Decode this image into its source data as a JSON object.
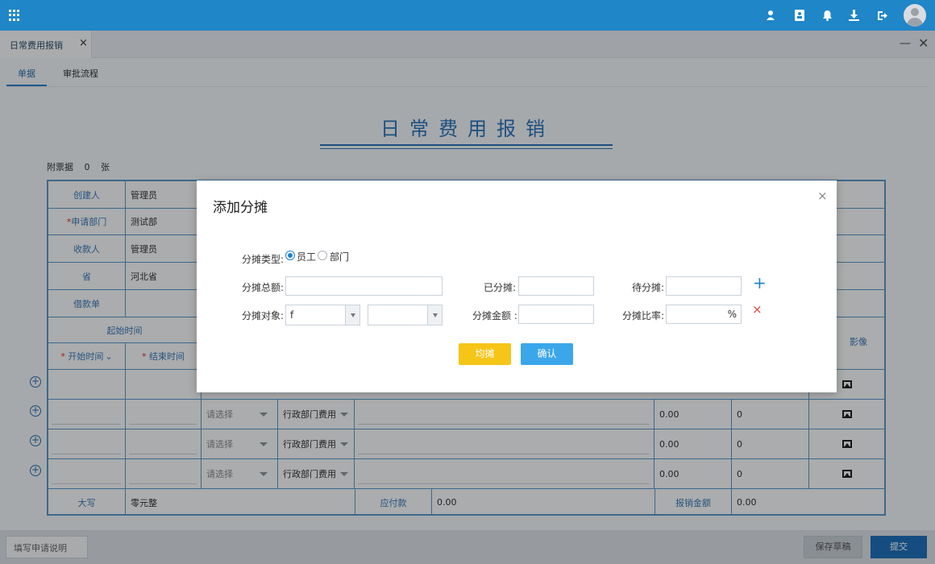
{
  "header": {
    "icons": [
      "apps-icon",
      "user-icon",
      "contacts-icon",
      "bell-icon",
      "download-icon",
      "logout-icon"
    ],
    "accent": "#1f86c8"
  },
  "tab": {
    "title": "日常费用报销",
    "close": "×"
  },
  "window": {
    "minimize": "—",
    "close": "✕"
  },
  "subtabs": [
    "单据",
    "审批流程"
  ],
  "form": {
    "title": "日常费用报销",
    "attach_label": "附票据",
    "attach_count": "0",
    "attach_unit": "张",
    "rows": [
      {
        "label": "创建人",
        "value": "管理员",
        "required": false
      },
      {
        "label": "申请部门",
        "value": "测试部",
        "required": true
      },
      {
        "label": "收款人",
        "value": "管理员",
        "required": false
      },
      {
        "label": "省",
        "value": "河北省",
        "required": false
      },
      {
        "label": "借款单",
        "value": "",
        "required": false
      }
    ],
    "start_time_header": "起始时间",
    "start_col": "开始时间",
    "end_col": "结束时间",
    "image_col": "影像",
    "line_items": [
      {
        "select": "",
        "type": "",
        "amount": "",
        "ratio": ""
      },
      {
        "select": "请选择",
        "type": "行政部门费用",
        "amount": "0.00",
        "ratio": "0"
      },
      {
        "select": "请选择",
        "type": "行政部门费用",
        "amount": "0.00",
        "ratio": "0"
      },
      {
        "select": "请选择",
        "type": "行政部门费用",
        "amount": "0.00",
        "ratio": "0"
      }
    ],
    "totals": {
      "capital_label": "大写",
      "capital_value": "零元整",
      "payable_label": "应付款",
      "payable_value": "0.00",
      "reimburse_label": "报销金额",
      "reimburse_value": "0.00"
    }
  },
  "footer": {
    "note_placeholder": "填写申请说明",
    "save_draft": "保存草稿",
    "submit": "提交"
  },
  "modal": {
    "title": "添加分摊",
    "close": "×",
    "type_label": "分摊类型:",
    "type_options": [
      "员工",
      "部门"
    ],
    "type_selected": "员工",
    "total_label": "分摊总额:",
    "total_value": "",
    "allocated_label": "已分摊:",
    "allocated_value": "",
    "pending_label": "待分摊:",
    "pending_value": "",
    "target_label": "分摊对象:",
    "target_value": "f",
    "target_sub_value": "",
    "amount_label": "分摊金额 :",
    "amount_value": "",
    "ratio_label": "分摊比率:",
    "ratio_value": "",
    "ratio_unit": "%",
    "add": "+",
    "remove": "×",
    "even_button": "均摊",
    "confirm_button": "确认"
  }
}
